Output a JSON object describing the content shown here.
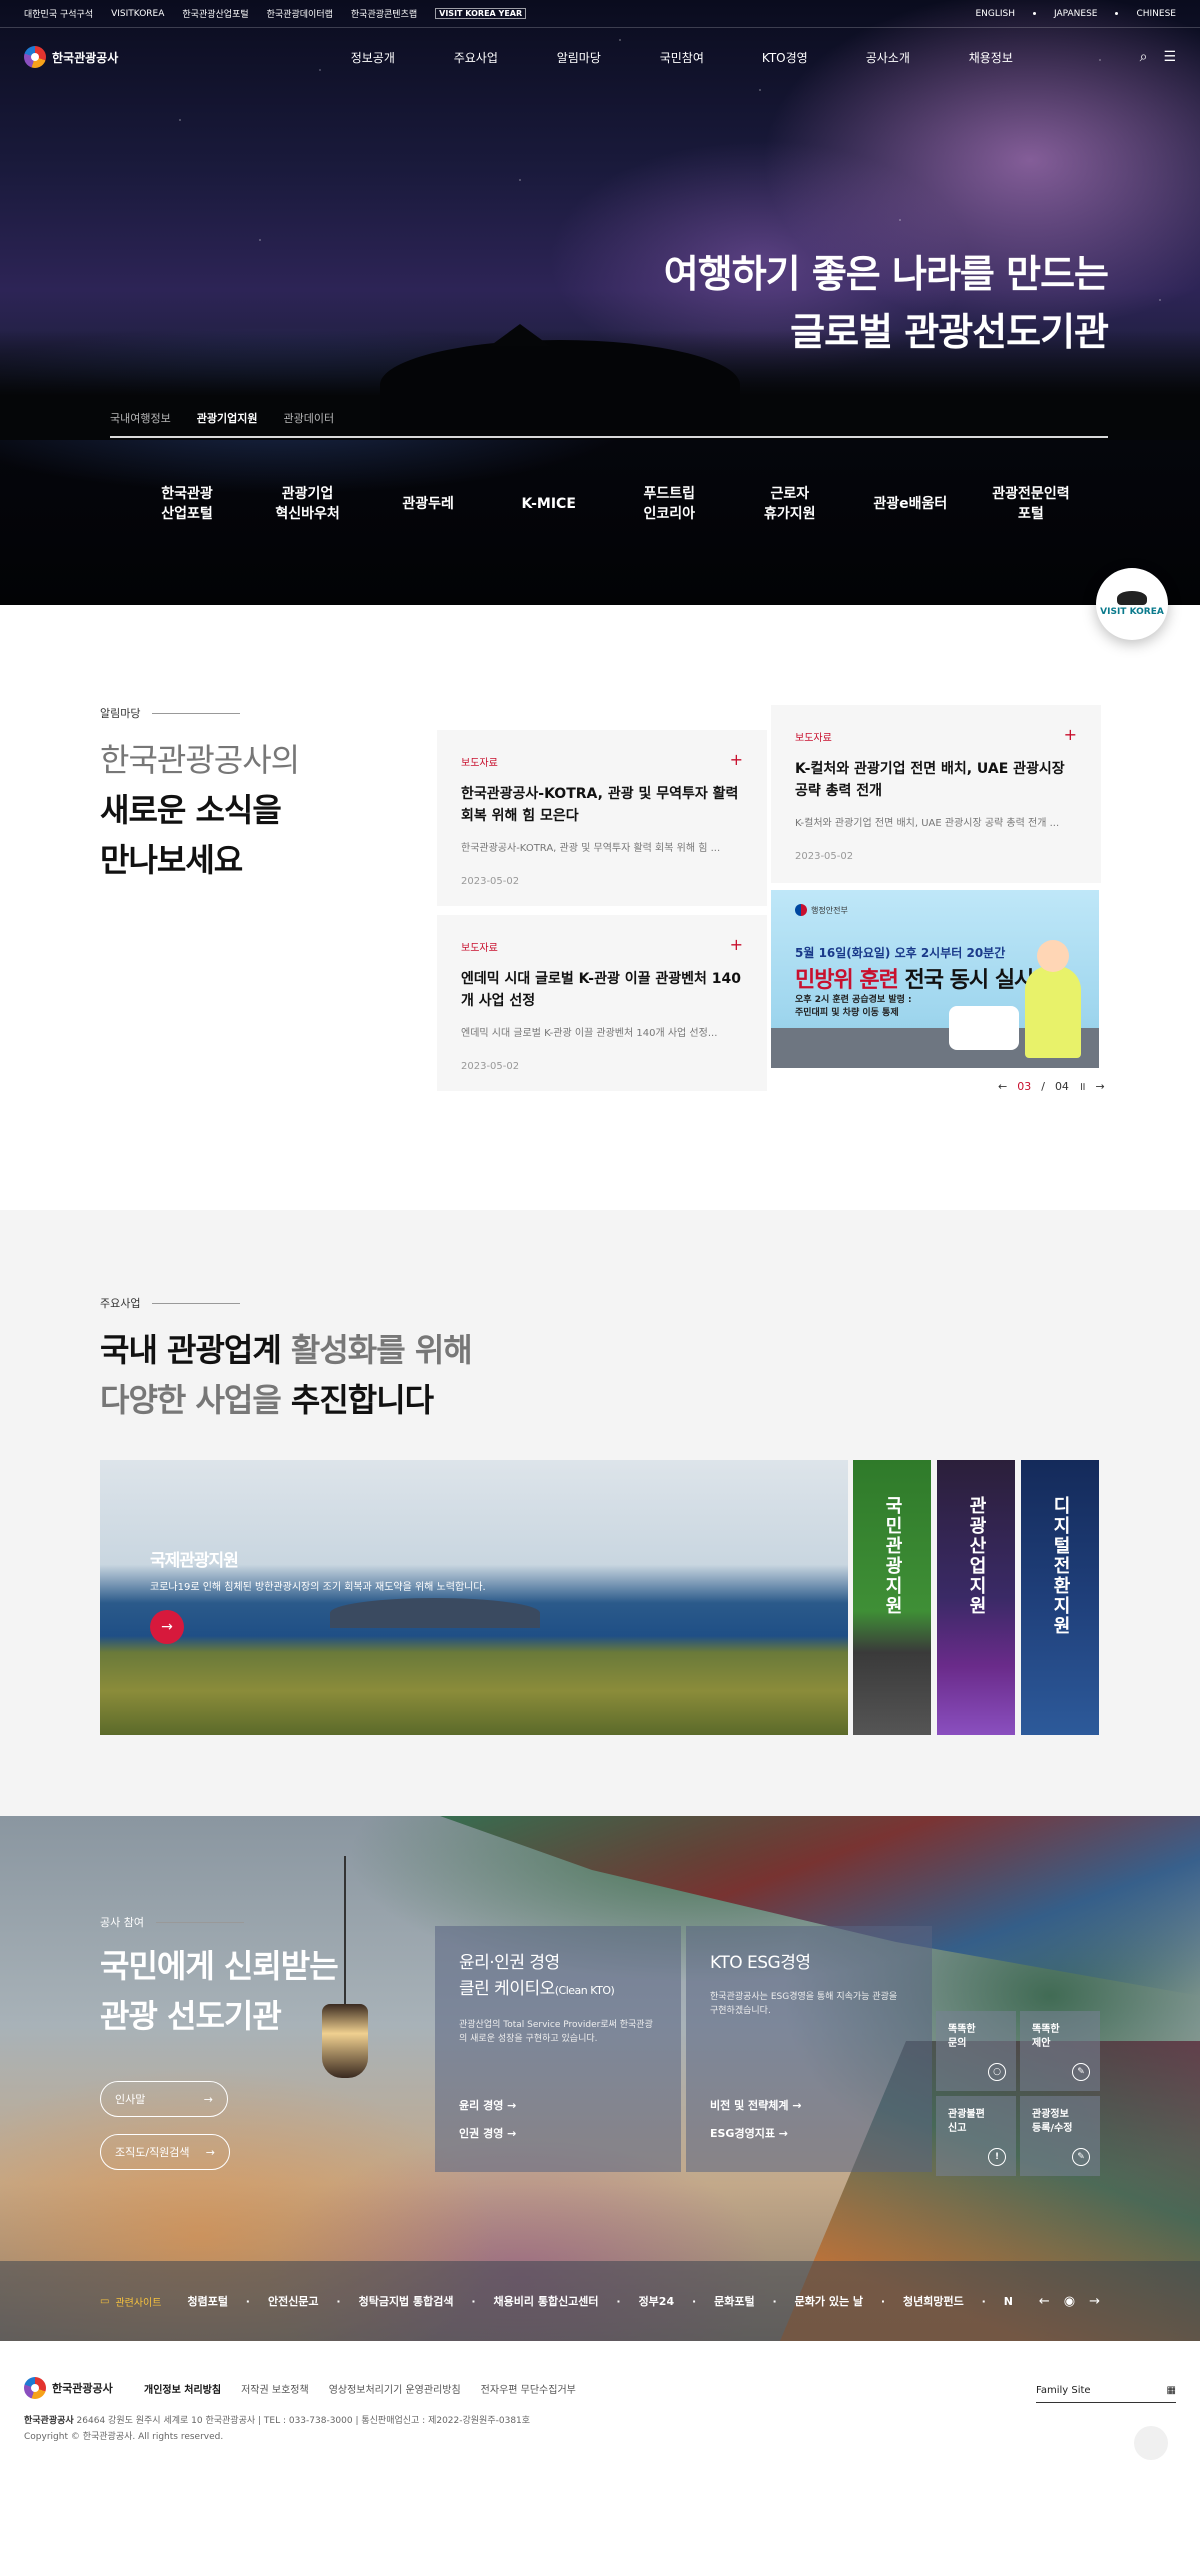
{
  "util": {
    "left": [
      "대한민국 구석구석",
      "VISITKOREA",
      "한국관광산업포털",
      "한국관광데이터랩",
      "한국관광콘텐츠랩"
    ],
    "visit_logo": "VISIT KOREA YEAR",
    "langs": [
      "ENGLISH",
      "JAPANESE",
      "CHINESE"
    ]
  },
  "header": {
    "logo_text": "한국관광공사",
    "menu": [
      "정보공개",
      "주요사업",
      "알림마당",
      "국민참여",
      "KTO경영",
      "공사소개",
      "채용정보"
    ],
    "search_icon": "⌕",
    "menu_icon": "☰"
  },
  "hero": {
    "title_line1": "여행하기 좋은 나라를 만드는",
    "title_line2": "글로벌 관광선도기관",
    "tabs": [
      "국내여행정보",
      "관광기업지원",
      "관광데이터"
    ],
    "quick": [
      [
        "한국관광",
        "산업포털"
      ],
      [
        "관광기업",
        "혁신바우처"
      ],
      [
        "관광두레",
        ""
      ],
      [
        "K-MICE",
        ""
      ],
      [
        "푸드트립",
        "인코리아"
      ],
      [
        "근로자",
        "휴가지원"
      ],
      [
        "관광e배움터",
        ""
      ],
      [
        "관광전문인력",
        "포털"
      ]
    ],
    "badge": "VISIT KOREA"
  },
  "news": {
    "label": "알림마당",
    "title_gray": "한국관광공사의",
    "title_bold1": "새로운 소식을",
    "title_bold2": "만나보세요",
    "cards": [
      {
        "tag": "보도자료",
        "title": "한국관광공사-KOTRA, 관광 및 무역투자 활력 회복 위해 힘 모은다",
        "desc": "한국관광공사-KOTRA, 관광 및 무역투자 활력 회복 위해 힘 ...",
        "date": "2023-05-02"
      },
      {
        "tag": "보도자료",
        "title": "K-컬처와 관광기업 전면 배치, UAE 관광시장 공략 총력 전개",
        "desc": "K-컬처와 관광기업 전면 배치, UAE 관광시장 공략 총력 전개 ...",
        "date": "2023-05-02"
      },
      {
        "tag": "보도자료",
        "title": "엔데믹 시대 글로벌 K-관광 이끌 관광벤처 140개 사업 선정",
        "desc": "엔데믹 시대 글로벌 K-관광 이끌 관광벤처 140개 사업 선정...",
        "date": "2023-05-02"
      }
    ],
    "banner": {
      "ministry": "행정안전부",
      "line1": "5월 16일(화요일) 오후 2시부터 20분간",
      "line2_red": "민방위 훈련",
      "line2_rest": " 전국 동시 실시!",
      "line3": "오후 2시 훈련 공습경보 발령 :",
      "line4": "주민대피 및 차량 이동 통제"
    },
    "pager": {
      "current": "03",
      "total": "04"
    }
  },
  "biz": {
    "label": "주요사업",
    "t1_bold": "국내 관광업계",
    "t1_rest": " 활성화를 위해",
    "t2_rest": "다양한 사업을 ",
    "t2_bold": "추진합니다",
    "main_title": "국제관광지원",
    "main_desc": "코로나19로 인해 침체된 방한관광시장의 조기 회복과 재도약을 위해 노력합니다.",
    "cols": [
      "국민관광지원",
      "관광산업지원",
      "디지털전환지원"
    ]
  },
  "part": {
    "label": "공사 참여",
    "title1": "국민에게 신뢰받는",
    "title2": "관광 선도기관",
    "btn1": "인사말",
    "btn2": "조직도/직원검색",
    "box1": {
      "title1": "윤리·인권 경영",
      "title2": "클린 케이티오",
      "title2_small": "(Clean KTO)",
      "desc": "관광산업의 Total Service Provider로써 한국관광의 새로운 성장을 구현하고 있습니다.",
      "link1": "윤리 경영",
      "link2": "인권 경영"
    },
    "box2": {
      "title1": "KTO ESG경영",
      "desc": "한국관광공사는 ESG경영을 통해 지속가능 관광을 구현하겠습니다.",
      "link1": "비전 및 전략체계",
      "link2": "ESG경영지표"
    },
    "small": [
      [
        "똑똑한",
        "문의"
      ],
      [
        "똑똑한",
        "제안"
      ],
      [
        "관광불편",
        "신고"
      ],
      [
        "관광정보",
        "등록/수정"
      ]
    ]
  },
  "related": {
    "label": "관련사이트",
    "sites": [
      "청렴포털",
      "안전신문고",
      "청탁금지법 통합검색",
      "채용비리 통합신고센터",
      "정부24",
      "문화포털",
      "문화가 있는 날",
      "청년희망펀드",
      "NIS국정원"
    ]
  },
  "footer": {
    "logo_text": "한국관광공사",
    "links": [
      "개인정보 처리방침",
      "저작권 보호정책",
      "영상정보처리기기 운영관리방침",
      "전자우편 무단수집거부"
    ],
    "org": "한국관광공사",
    "address": " 26464 강원도 원주시 세계로 10 한국관광공사 | TEL : 033-738-3000 | 통신판매업신고 : 제2022-강원원주-0381호",
    "copyright": "Copyright © 한국관광공사. All rights reserved.",
    "family": "Family Site"
  }
}
